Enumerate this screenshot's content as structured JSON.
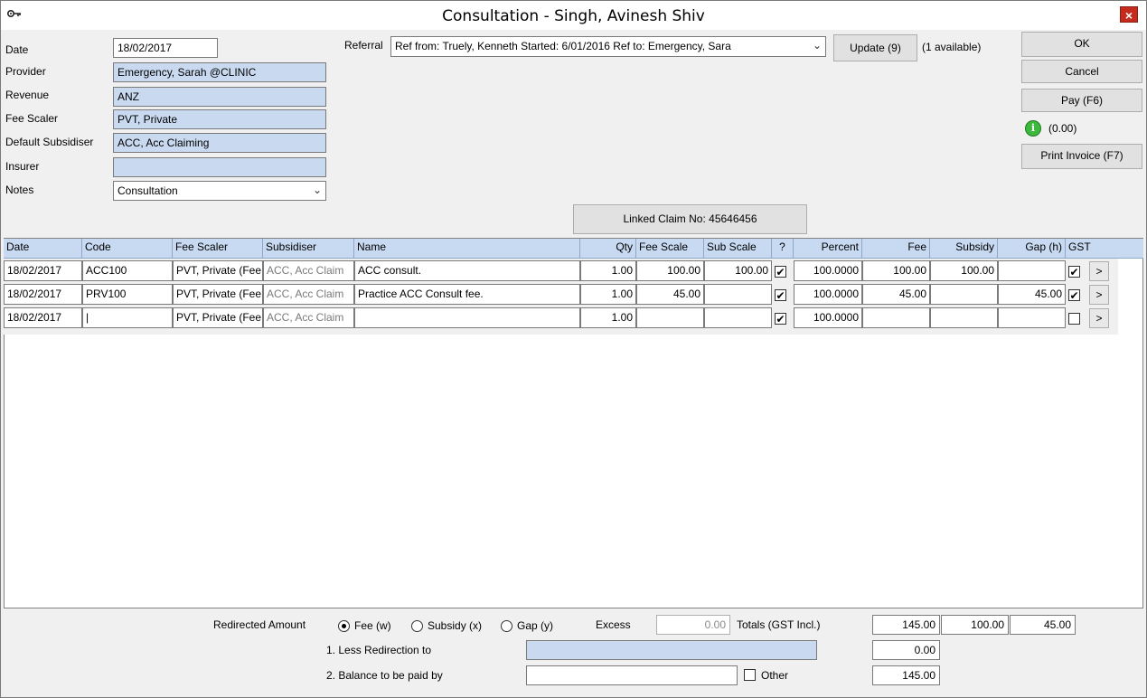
{
  "window": {
    "title": "Consultation - Singh, Avinesh Shiv",
    "icon": "key-icon",
    "close_glyph": "×"
  },
  "form": {
    "date_label": "Date",
    "date_value": "18/02/2017",
    "provider_label": "Provider",
    "provider_value": "Emergency, Sarah @CLINIC",
    "revenue_label": "Revenue",
    "revenue_value": "ANZ",
    "fee_scaler_label": "Fee Scaler",
    "fee_scaler_value": "PVT, Private",
    "default_subsidiser_label": "Default Subsidiser",
    "default_subsidiser_value": "ACC, Acc Claiming",
    "insurer_label": "Insurer",
    "insurer_value": "",
    "notes_label": "Notes",
    "notes_value": "Consultation"
  },
  "referral": {
    "label": "Referral",
    "value": "Ref from: Truely, Kenneth Started: 6/01/2016 Ref to: Emergency, Sara",
    "update_button": "Update (9)",
    "available_text": "(1 available)"
  },
  "linked_claim": "Linked Claim No: 45646456",
  "actions": {
    "ok": "OK",
    "cancel": "Cancel",
    "pay": "Pay (F6)",
    "balance": "(0.00)",
    "print_invoice": "Print Invoice (F7)"
  },
  "grid": {
    "headers": [
      "Date",
      "Code",
      "Fee Scaler",
      "Subsidiser",
      "Name",
      "Qty",
      "Fee Scale",
      "Sub Scale",
      "?",
      "Percent",
      "Fee",
      "Subsidy",
      "Gap (h)",
      "GST"
    ],
    "rows": [
      {
        "date": "18/02/2017",
        "code": "ACC100",
        "fee_scaler": "PVT, Private (Fee",
        "subsidiser": "ACC, Acc Claim",
        "name": "ACC consult.",
        "qty": "1.00",
        "fee_scale": "100.00",
        "sub_scale": "100.00",
        "q": "✔",
        "percent": "100.0000",
        "fee": "100.00",
        "subsidy": "100.00",
        "gap": "",
        "gst": "✔",
        "more": ">"
      },
      {
        "date": "18/02/2017",
        "code": "PRV100",
        "fee_scaler": "PVT, Private (Fee",
        "subsidiser": "ACC, Acc Claim",
        "name": "Practice ACC Consult fee.",
        "qty": "1.00",
        "fee_scale": "45.00",
        "sub_scale": "",
        "q": "✔",
        "percent": "100.0000",
        "fee": "45.00",
        "subsidy": "",
        "gap": "45.00",
        "gst": "✔",
        "more": ">"
      },
      {
        "date": "18/02/2017",
        "code": "|",
        "fee_scaler": "PVT, Private (Fee",
        "subsidiser": "ACC, Acc Claim",
        "name": "",
        "qty": "1.00",
        "fee_scale": "",
        "sub_scale": "",
        "q": "✔",
        "percent": "100.0000",
        "fee": "",
        "subsidy": "",
        "gap": "",
        "gst": "",
        "more": ">"
      }
    ]
  },
  "footer": {
    "redirected_amount_label": "Redirected Amount",
    "radio_fee": "Fee (w)",
    "radio_subsidy": "Subsidy (x)",
    "radio_gap": "Gap (y)",
    "excess_label": "Excess",
    "excess_value": "0.00",
    "totals_label": "Totals (GST Incl.)",
    "total_fee": "145.00",
    "total_subsidy": "100.00",
    "total_gap": "45.00",
    "less_redirection_label": "1. Less Redirection to",
    "less_redirection_value": "",
    "less_redirection_amount": "0.00",
    "balance_label": "2. Balance to be paid by",
    "balance_value": "",
    "other_label": "Other",
    "balance_amount": "145.00"
  }
}
